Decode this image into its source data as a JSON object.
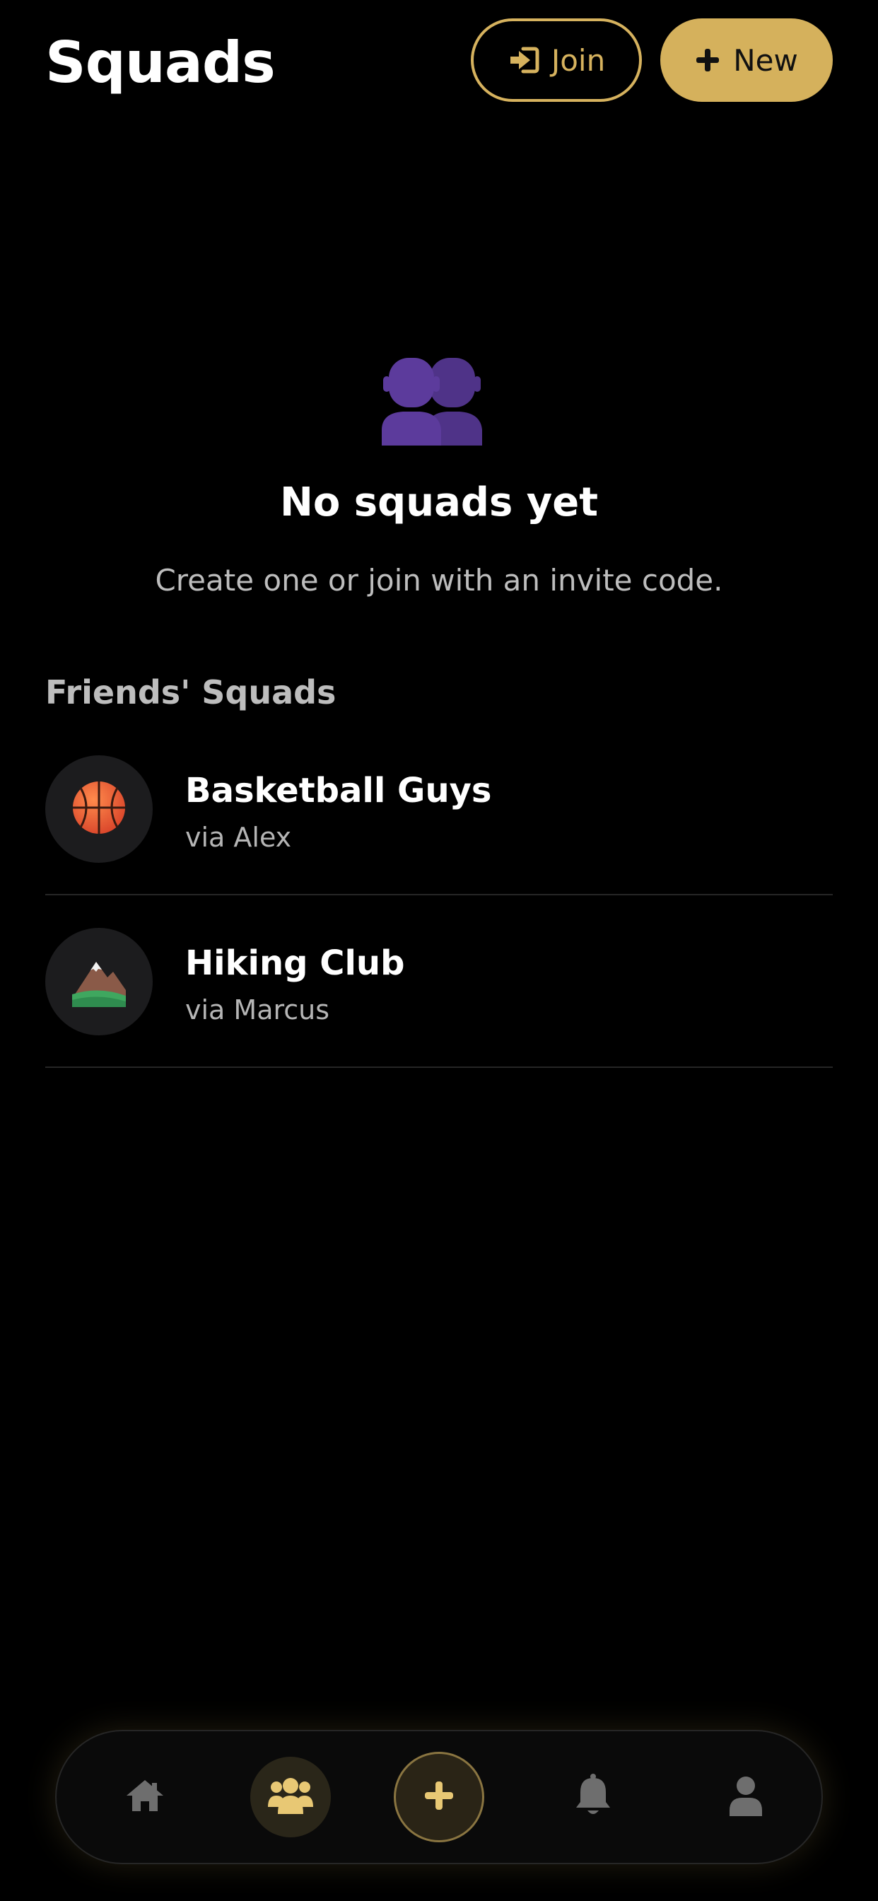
{
  "header": {
    "title": "Squads",
    "join_label": "Join",
    "new_label": "New",
    "join_icon": "sign-in-icon",
    "new_icon": "plus-icon"
  },
  "empty_state": {
    "icon": "people-silhouette-icon",
    "title": "No squads yet",
    "subtitle": "Create one or join with an invite code."
  },
  "friends_squads": {
    "heading": "Friends' Squads",
    "items": [
      {
        "name": "Basketball Guys",
        "via": "via Alex",
        "icon": "basketball-icon"
      },
      {
        "name": "Hiking Club",
        "via": "via Marcus",
        "icon": "mountain-icon"
      }
    ]
  },
  "nav": {
    "items": [
      {
        "icon": "home-icon",
        "active": false
      },
      {
        "icon": "users-icon",
        "active": true
      },
      {
        "icon": "plus-icon",
        "active": false
      },
      {
        "icon": "bell-icon",
        "active": false
      },
      {
        "icon": "user-icon",
        "active": false
      }
    ]
  },
  "colors": {
    "accent": "#d5b15c",
    "background": "#000000",
    "muted_text": "#bdbdbd",
    "avatar_bg": "#1c1c1e",
    "empty_icon": "#5b3a99"
  }
}
